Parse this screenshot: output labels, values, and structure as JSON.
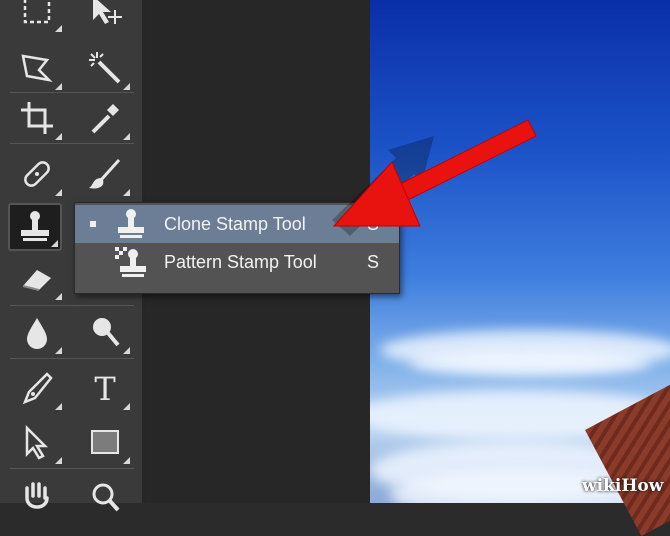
{
  "toolbar": {
    "tools": [
      {
        "name": "marquee-tool"
      },
      {
        "name": "move-tool"
      },
      {
        "name": "polygonal-lasso-tool"
      },
      {
        "name": "magic-wand-tool"
      },
      {
        "name": "crop-tool"
      },
      {
        "name": "eyedropper-tool"
      },
      {
        "name": "spot-healing-brush-tool"
      },
      {
        "name": "brush-tool"
      },
      {
        "name": "clone-stamp-tool",
        "active": true
      },
      {
        "name": "eraser-tool"
      },
      {
        "name": "blur-tool"
      },
      {
        "name": "dodge-tool"
      },
      {
        "name": "pen-tool"
      },
      {
        "name": "type-tool",
        "glyph": "T"
      },
      {
        "name": "path-selection-tool"
      },
      {
        "name": "rectangle-tool"
      },
      {
        "name": "hand-tool"
      },
      {
        "name": "zoom-tool"
      }
    ]
  },
  "flyout": {
    "items": [
      {
        "label": "Clone Stamp Tool",
        "shortcut": "S",
        "selected": true
      },
      {
        "label": "Pattern Stamp Tool",
        "shortcut": "S",
        "selected": false
      }
    ]
  },
  "watermark": "wikiHow",
  "colors": {
    "toolbar_bg": "#3a3a3a",
    "flyout_bg": "#535353",
    "flyout_selected": "#6c7e95",
    "arrow": "#ee1111"
  }
}
